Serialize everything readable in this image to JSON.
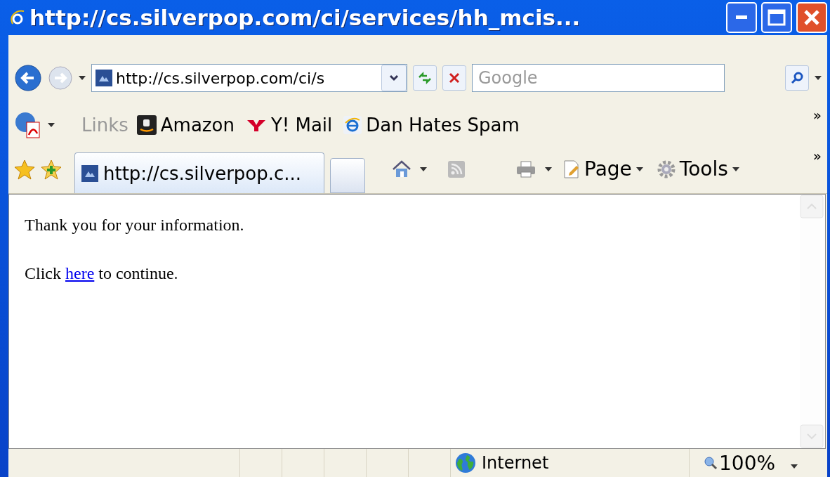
{
  "window": {
    "title": "http://cs.silverpop.com/ci/services/hh_mcis..."
  },
  "address_bar": {
    "url": "http://cs.silverpop.com/ci/s"
  },
  "search": {
    "placeholder": "Google"
  },
  "links_bar": {
    "label": "Links",
    "links": [
      {
        "label": "Amazon",
        "kind": "amazon"
      },
      {
        "label": "Y! Mail",
        "kind": "yahoo"
      },
      {
        "label": "Dan Hates Spam",
        "kind": "ie"
      }
    ],
    "more": "»"
  },
  "tabs": [
    {
      "label": "http://cs.silverpop.c...",
      "selected": true
    }
  ],
  "command_bar": {
    "buttons": [
      {
        "label": "Page",
        "kind": "page"
      },
      {
        "label": "Tools",
        "kind": "tools"
      }
    ],
    "more": "»"
  },
  "content": {
    "paragraphs": [
      {
        "text": "Thank you for your information."
      },
      {
        "before": "Click",
        "link": "here",
        "after": "to continue."
      }
    ]
  },
  "status_bar": {
    "zone": "Internet",
    "zoom": "100%"
  }
}
